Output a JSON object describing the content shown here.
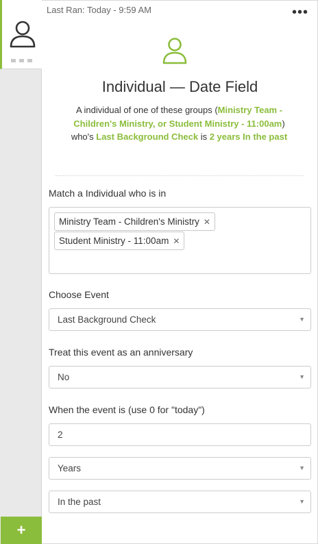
{
  "header": {
    "last_ran": "Last Ran: Today - 9:59 AM",
    "menu_glyph": "•••"
  },
  "rail": {
    "add_glyph": "+"
  },
  "card": {
    "title": "Individual — Date Field",
    "description": {
      "p1": "A individual of one of these groups (",
      "groups": "Ministry Team - Children's Ministry, or Student Ministry - 11:00am",
      "p2": ") who's ",
      "event": "Last Background Check",
      "p3": " is ",
      "when": "2 years In the past"
    }
  },
  "match": {
    "label": "Match a Individual who is in",
    "chips": [
      "Ministry Team - Children's Ministry",
      "Student Ministry - 11:00am"
    ],
    "remove_glyph": "✕"
  },
  "event": {
    "label": "Choose Event",
    "value": "Last Background Check"
  },
  "anniversary": {
    "label": "Treat this event as an anniversary",
    "value": "No"
  },
  "when": {
    "label": "When the event is (use 0 for \"today\")",
    "amount": "2",
    "unit": "Years",
    "direction": "In the past"
  },
  "caret_glyph": "▼",
  "colors": {
    "accent": "#8bbd3c",
    "rail": "#e9e9e9",
    "border": "#cccccc"
  }
}
